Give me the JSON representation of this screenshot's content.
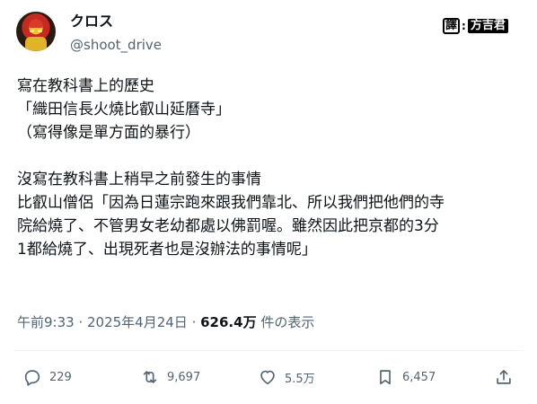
{
  "user": {
    "display_name": "クロス",
    "handle": "@shoot_drive"
  },
  "translator_badge": {
    "prefix": "譯",
    "separator": ":",
    "name": "方吉君"
  },
  "tweet": {
    "lines_block1": [
      "寫在教科書上的歷史",
      "「織田信長火燒比叡山延曆寺」",
      "（寫得像是單方面的暴行）"
    ],
    "lines_block2": [
      "沒寫在教科書上稍早之前發生的事情",
      "比叡山僧侶「因為日蓮宗跑來跟我們靠北、所以我們把他們的寺",
      "院給燒了、不管男女老幼都處以佛罰喔。雖然因此把京都的3分",
      "1都給燒了、出現死者也是沒辦法的事情呢」"
    ]
  },
  "meta": {
    "time": "午前9:33",
    "sep1": " · ",
    "date": "2025年4月24日",
    "sep2": " · ",
    "views": "626.4万",
    "views_suffix": " 件の表示"
  },
  "actions": {
    "replies": "229",
    "reposts": "9,697",
    "likes": "5.5万",
    "bookmarks": "6,457"
  },
  "icons": [
    "reply-icon",
    "repost-icon",
    "like-icon",
    "bookmark-icon",
    "share-icon"
  ]
}
